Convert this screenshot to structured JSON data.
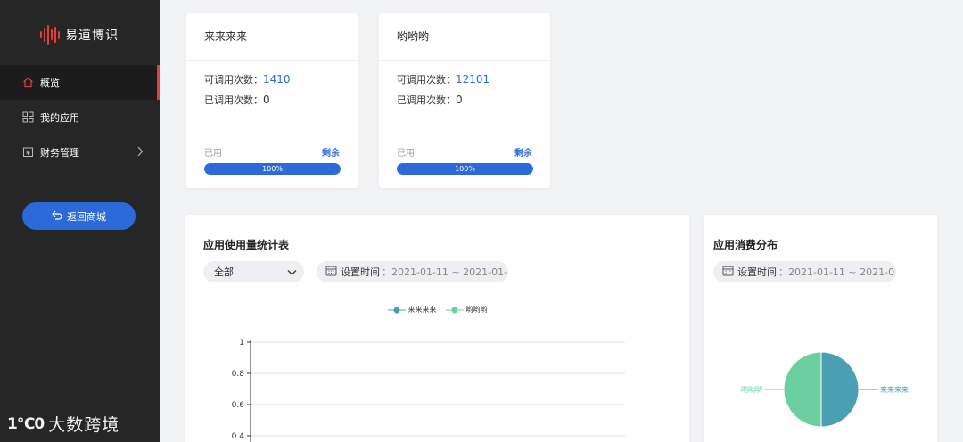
{
  "sidebar": {
    "logo_text": "易道博识",
    "items": [
      {
        "label": "概览",
        "icon": "home-icon",
        "active": true
      },
      {
        "label": "我的应用",
        "icon": "grid-icon"
      },
      {
        "label": "财务管理",
        "icon": "wallet-icon"
      }
    ],
    "back_button": "返回商城"
  },
  "watermark": {
    "mark": "1℃0",
    "text": "大数跨境"
  },
  "apps": [
    {
      "name": "来来来来",
      "available_label": "可调用次数：",
      "available": "1410",
      "called_label": "已调用次数：",
      "called": "0",
      "used_label": "已用",
      "remaining_label": "剩余",
      "progress_text": "100%",
      "progress": 1.0
    },
    {
      "name": "哟哟哟",
      "available_label": "可调用次数：",
      "available": "12101",
      "called_label": "已调用次数：",
      "called": "0",
      "used_label": "已用",
      "remaining_label": "剩余",
      "progress_text": "100%",
      "progress": 1.0
    }
  ],
  "usage": {
    "title": "应用使用量统计表",
    "select_value": "全部",
    "date_label": "设置时间",
    "date_value": "：2021-01-11 ~ 2021-01-"
  },
  "distribution": {
    "title": "应用消费分布",
    "date_label": "设置时间",
    "date_value": "：2021-01-11 ~ 2021-01-"
  },
  "colors": {
    "accent": "#2c6ad9",
    "brand_red": "#e0403a",
    "series1": "#4a9fb5",
    "series2": "#6ccfa0",
    "sidebar": "#262626"
  },
  "chart_data": [
    {
      "type": "line",
      "series": [
        {
          "name": "来来来来",
          "values": []
        },
        {
          "name": "哟哟哟",
          "values": []
        }
      ],
      "y_ticks": [
        "1",
        "0.8",
        "0.6",
        "0.4"
      ],
      "ylim": [
        0,
        1
      ],
      "grid": true,
      "legend_position": "top-center"
    },
    {
      "type": "pie",
      "series": [
        {
          "name": "来来来来",
          "value": 0.5
        },
        {
          "name": "哟哟哟",
          "value": 0.5
        }
      ]
    }
  ]
}
